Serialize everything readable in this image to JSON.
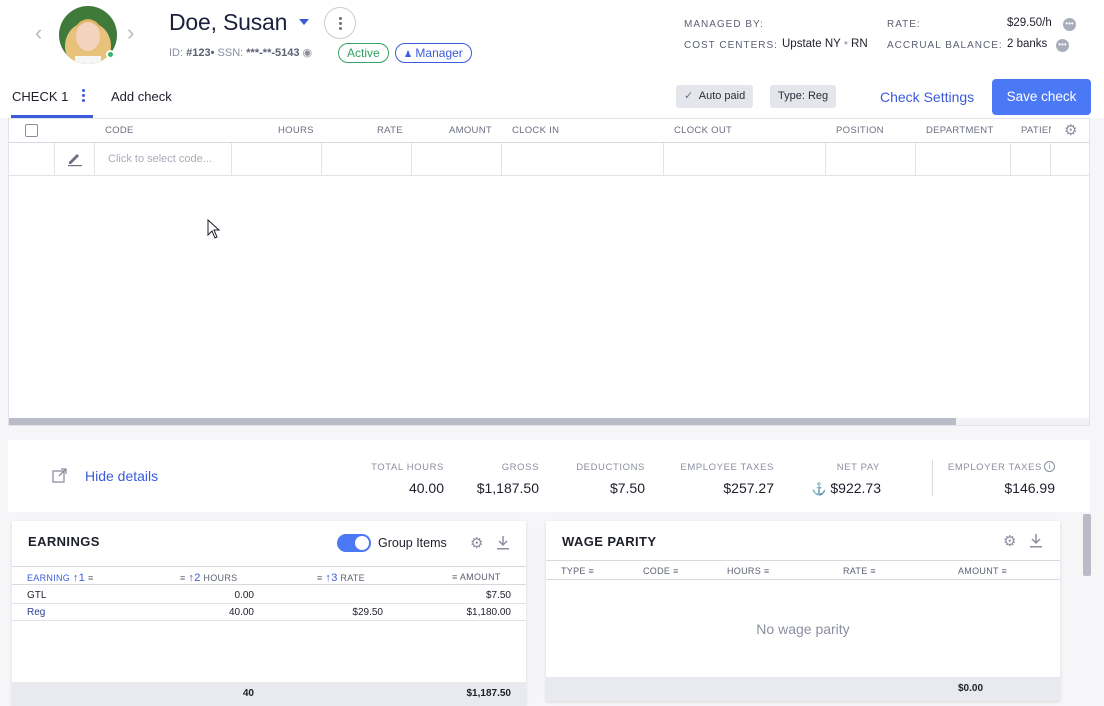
{
  "header": {
    "name": "Doe, Susan",
    "id_label": "ID:",
    "id_value": "#123",
    "ssn_label": "SSN:",
    "ssn_value": "***-**-5143",
    "status_badge": "Active",
    "role_badge": "Manager",
    "managed_by_label": "MANAGED BY:",
    "managed_by_value": "",
    "cost_centers_label": "COST CENTERS:",
    "cost_centers_value": "Upstate NY",
    "cost_centers_value2": "RN",
    "rate_label": "RATE:",
    "rate_value": "$29.50/h",
    "accrual_label": "ACCRUAL BALANCE:",
    "accrual_value": "2 banks"
  },
  "tabs": {
    "check_tab": "CHECK 1",
    "add_check": "Add check",
    "auto_paid": "Auto paid",
    "type_chip": "Type: Reg",
    "check_settings": "Check Settings",
    "save_check": "Save check"
  },
  "grid": {
    "columns": [
      "CODE",
      "HOURS",
      "RATE",
      "AMOUNT",
      "CLOCK IN",
      "CLOCK OUT",
      "POSITION",
      "DEPARTMENT",
      "PATIEN"
    ],
    "code_placeholder": "Click to select code..."
  },
  "totals": {
    "hide_details": "Hide details",
    "total_hours_label": "TOTAL HOURS",
    "total_hours_value": "40.00",
    "gross_label": "GROSS",
    "gross_value": "$1,187.50",
    "deductions_label": "DEDUCTIONS",
    "deductions_value": "$7.50",
    "employee_taxes_label": "EMPLOYEE TAXES",
    "employee_taxes_value": "$257.27",
    "net_pay_label": "NET PAY",
    "net_pay_value": "$922.73",
    "employer_taxes_label": "EMPLOYER TAXES",
    "employer_taxes_value": "$146.99"
  },
  "earnings": {
    "title": "EARNINGS",
    "group_items_label": "Group Items",
    "group_items_on": true,
    "col_earning": "EARNING",
    "sort1": "1",
    "sort2": "2",
    "col_hours": "HOURS",
    "sort3": "3",
    "col_rate": "RATE",
    "col_amount": "AMOUNT",
    "rows": [
      {
        "earning": "GTL",
        "hours": "0.00",
        "rate": "",
        "amount": "$7.50"
      },
      {
        "earning": "Reg",
        "hours": "40.00",
        "rate": "$29.50",
        "amount": "$1,180.00"
      }
    ],
    "footer_hours": "40",
    "footer_amount": "$1,187.50"
  },
  "wage_parity": {
    "title": "WAGE PARITY",
    "col_type": "TYPE",
    "col_code": "CODE",
    "col_hours": "HOURS",
    "col_rate": "RATE",
    "col_amount": "AMOUNT",
    "empty_text": "No wage parity",
    "footer_amount": "$0.00"
  },
  "colors": {
    "accent": "#3b5bdb",
    "primary_button": "#4b79f6",
    "active_green": "#2f9e5e"
  }
}
